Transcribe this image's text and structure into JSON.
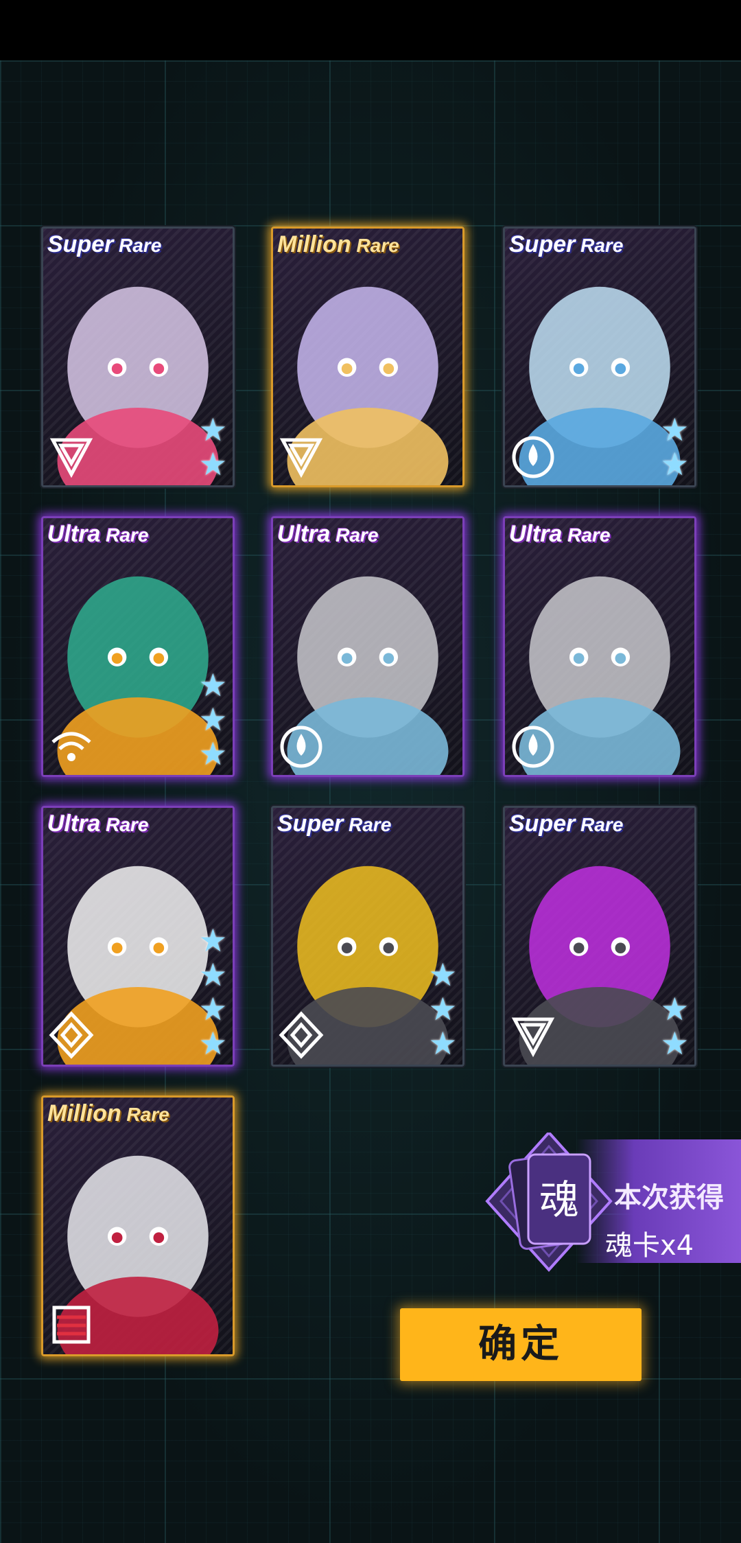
{
  "cards": [
    {
      "rarity_main": "Super",
      "rarity_sub": "Rare",
      "tier": "sr",
      "stars": 2,
      "type_icon": "triangle-element-icon",
      "art": "chibi-pink-hair-visor"
    },
    {
      "rarity_main": "Million",
      "rarity_sub": "Rare",
      "tier": "mr",
      "stars": 0,
      "type_icon": "triangle-element-icon",
      "art": "lavender-hair-girl"
    },
    {
      "rarity_main": "Super",
      "rarity_sub": "Rare",
      "tier": "sr",
      "stars": 2,
      "type_icon": "drop-element-icon",
      "art": "chibi-blue-hair-visor"
    },
    {
      "rarity_main": "Ultra",
      "rarity_sub": "Rare",
      "tier": "ur",
      "stars": 3,
      "type_icon": "signal-element-icon",
      "art": "green-mech-beast"
    },
    {
      "rarity_main": "Ultra",
      "rarity_sub": "Rare",
      "tier": "ur",
      "stars": 0,
      "type_icon": "drop-element-icon",
      "art": "silver-hair-girl"
    },
    {
      "rarity_main": "Ultra",
      "rarity_sub": "Rare",
      "tier": "ur",
      "stars": 0,
      "type_icon": "drop-element-icon",
      "art": "silver-hair-girl"
    },
    {
      "rarity_main": "Ultra",
      "rarity_sub": "Rare",
      "tier": "ur",
      "stars": 4,
      "type_icon": "diamond-element-icon",
      "art": "white-orange-mech"
    },
    {
      "rarity_main": "Super",
      "rarity_sub": "Rare",
      "tier": "sr",
      "stars": 3,
      "type_icon": "diamond-element-icon",
      "art": "yellow-bomb-creature"
    },
    {
      "rarity_main": "Super",
      "rarity_sub": "Rare",
      "tier": "sr",
      "stars": 2,
      "type_icon": "triangle-element-icon",
      "art": "purple-bomb-creature"
    },
    {
      "rarity_main": "Million",
      "rarity_sub": "Rare",
      "tier": "mr",
      "stars": 0,
      "type_icon": "stripe-element-icon",
      "art": "white-twintail-girl"
    }
  ],
  "soul_reward": {
    "icon_char": "魂",
    "line1": "本次获得",
    "line2": "魂卡x4"
  },
  "confirm_label": "确定"
}
